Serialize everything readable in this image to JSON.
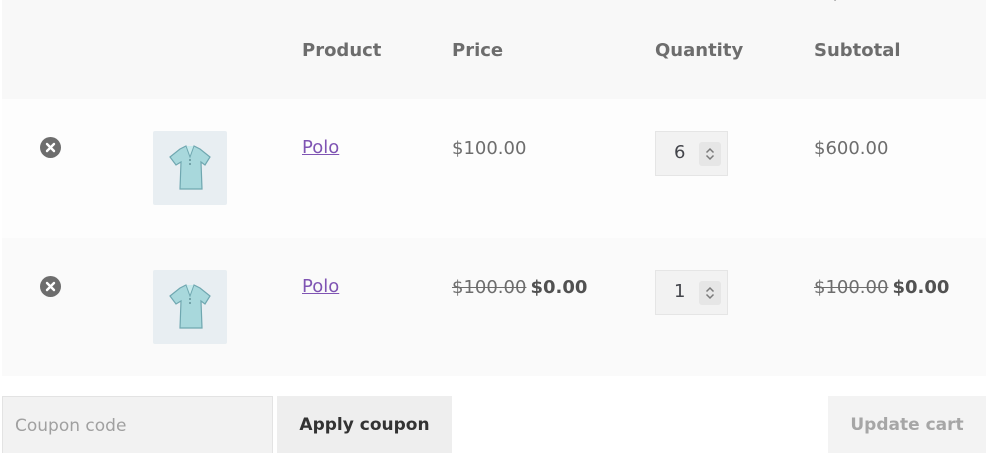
{
  "table": {
    "headers": {
      "product": "Product",
      "price": "Price",
      "quantity": "Quantity",
      "subtotal": "Subtotal"
    }
  },
  "items": [
    {
      "name": "Polo",
      "price": "$100.00",
      "quantity": "6",
      "subtotal": "$600.00",
      "thumbnail_icon": "polo-shirt-icon",
      "remove_icon": "remove-circle-icon"
    },
    {
      "name": "Polo",
      "price_original": "$100.00",
      "price_sale": "$0.00",
      "quantity": "1",
      "subtotal_original": "$100.00",
      "subtotal_sale": "$0.00",
      "thumbnail_icon": "polo-shirt-icon",
      "remove_icon": "remove-circle-icon"
    }
  ],
  "actions": {
    "coupon_placeholder": "Coupon code",
    "apply_coupon_label": "Apply coupon",
    "update_cart_label": "Update cart"
  },
  "colors": {
    "link": "#7f54b3",
    "text": "#6d6d6d",
    "header_bg": "#f8f8f8"
  }
}
